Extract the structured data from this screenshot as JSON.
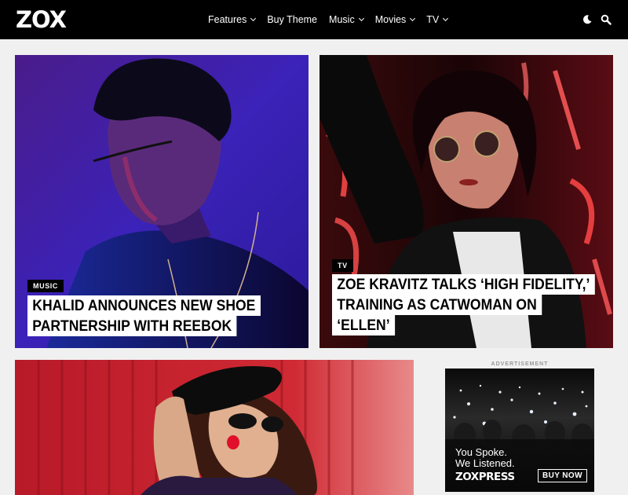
{
  "header": {
    "logo": "ZOX",
    "nav": [
      {
        "label": "Features",
        "dropdown": true
      },
      {
        "label": "Buy Theme",
        "dropdown": false
      },
      {
        "label": "Music",
        "dropdown": true
      },
      {
        "label": "Movies",
        "dropdown": true
      },
      {
        "label": "TV",
        "dropdown": true
      }
    ],
    "icons": [
      "moon-icon",
      "search-icon"
    ]
  },
  "featured": [
    {
      "category": "MUSIC",
      "headline_lines": [
        "KHALID ANNOUNCES NEW SHOE",
        "PARTNERSHIP WITH REEBOK"
      ]
    },
    {
      "category": "TV",
      "headline_lines": [
        "ZOE KRAVITZ TALKS ‘HIGH FIDELITY,’",
        "TRAINING AS CATWOMAN ON",
        "‘ELLEN’"
      ]
    }
  ],
  "ad": {
    "label": "ADVERTISEMENT",
    "line1": "You Spoke.",
    "line2": "We Listened.",
    "brand": "ZOXPRESS",
    "button": "BUY NOW"
  },
  "colors": {
    "header_bg": "#000000",
    "page_bg": "#f0f0f0",
    "card1_bg": "#3a1fa0",
    "card2_bg": "#2a0608",
    "card3_bg": "#c41e2a"
  }
}
